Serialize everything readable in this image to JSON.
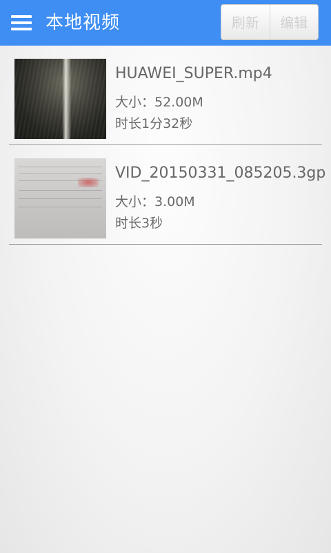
{
  "appbar": {
    "title": "本地视频",
    "refresh_label": "刷新",
    "edit_label": "编辑",
    "color": "#3e8ef4"
  },
  "videos": [
    {
      "filename": "HUAWEI_SUPER.mp4",
      "size": "大小：52.00M",
      "duration": "时长1分32秒"
    },
    {
      "filename": "VID_20150331_085205.3gp",
      "size": "大小：3.00M",
      "duration": "时长3秒"
    }
  ]
}
